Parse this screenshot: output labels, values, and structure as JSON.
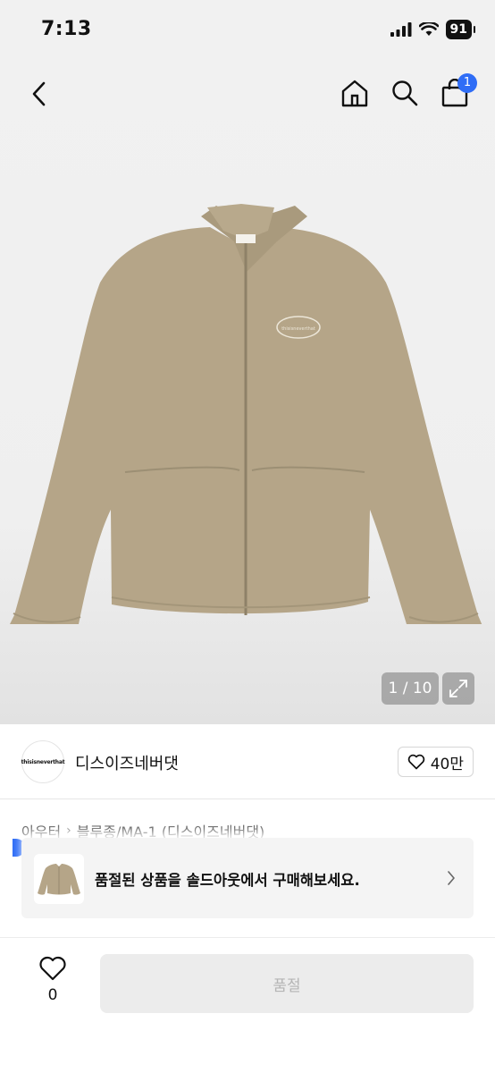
{
  "status": {
    "time": "7:13",
    "battery": "91"
  },
  "nav": {
    "cart_count": "1"
  },
  "gallery": {
    "counter": "1 / 10",
    "product_logo_text": "thisisneverthat"
  },
  "brand": {
    "logo_text": "thisisneverthat",
    "name": "디스이즈네버댓",
    "likes": "40만"
  },
  "breadcrumb": {
    "items": [
      "아우터",
      "블루종/MA-1 (디스이즈네버댓)"
    ]
  },
  "soldout_banner": {
    "text": "품절된 상품을 솔드아웃에서 구매해보세요."
  },
  "bottom": {
    "wish_count": "0",
    "buy_label": "품절"
  },
  "colors": {
    "accent": "#2f6df6",
    "jacket": "#b5a588",
    "disabled_bg": "#ececec"
  }
}
